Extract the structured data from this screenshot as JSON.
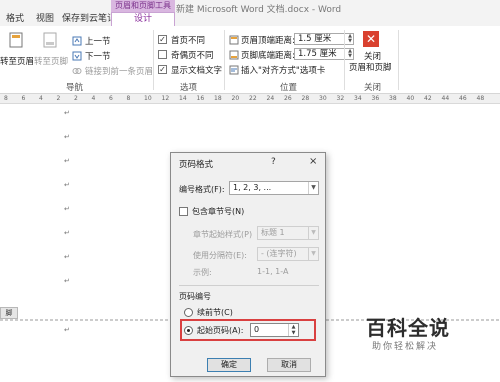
{
  "window": {
    "tabs": [
      "格式",
      "视图",
      "保存到云笔记"
    ],
    "context_header": "页眉和页脚工具",
    "context_tab": "设计",
    "doc_title": "新建 Microsoft Word 文档.docx - Word"
  },
  "ribbon": {
    "nav": {
      "goto_header": "转至页眉",
      "goto_footer": "转至页脚",
      "prev": "上一节",
      "next": "下一节",
      "link_prev": "链接到前一条页眉",
      "group": "导航"
    },
    "options": {
      "first_page": "首页不同",
      "odd_even": "奇偶页不同",
      "show_text": "显示文档文字",
      "first_page_checked": true,
      "odd_even_checked": false,
      "show_text_checked": true,
      "group": "选项"
    },
    "position": {
      "header_top_label": "页眉顶端距离:",
      "header_top_value": "1.5 厘米",
      "footer_bottom_label": "页脚底端距离:",
      "footer_bottom_value": "1.75 厘米",
      "insert_align_tab": "插入\"对齐方式\"选项卡",
      "group": "位置"
    },
    "close": {
      "button": "关闭\n页眉和页脚",
      "button_line1": "关闭",
      "button_line2": "页眉和页脚",
      "group": "关闭"
    }
  },
  "ruler": {
    "numbers": [
      "8",
      "6",
      "4",
      "2",
      "2",
      "4",
      "6",
      "8",
      "10",
      "12",
      "14",
      "16",
      "18",
      "20",
      "22",
      "24",
      "26",
      "28",
      "30",
      "32",
      "34",
      "36",
      "38",
      "40",
      "42",
      "44",
      "46",
      "48"
    ]
  },
  "document": {
    "paragraph_mark": "↵",
    "side_label": "脚"
  },
  "dialog": {
    "title": "页码格式",
    "help": "?",
    "close": "×",
    "format_label": "编号格式(F):",
    "format_value": "1, 2, 3, ...",
    "include_chapter": "包含章节号(N)",
    "chapter_style_label": "章节起始样式(P)",
    "chapter_style_value": "标题 1",
    "separator_label": "使用分隔符(E):",
    "separator_value": "- (连字符)",
    "example_label": "示例:",
    "example_value": "1-1, 1-A",
    "numbering_group": "页码编号",
    "continue_label": "续前节(C)",
    "start_at_label": "起始页码(A):",
    "start_at_value": "0",
    "ok": "确定",
    "cancel": "取消"
  },
  "watermark": {
    "main": "百科全说",
    "sub": "助你轻松解决"
  },
  "colors": {
    "accent": "#8a2f9c",
    "context_header_bg": "#d9b7e0",
    "close_icon": "#d9412f",
    "highlight": "#d94040"
  }
}
